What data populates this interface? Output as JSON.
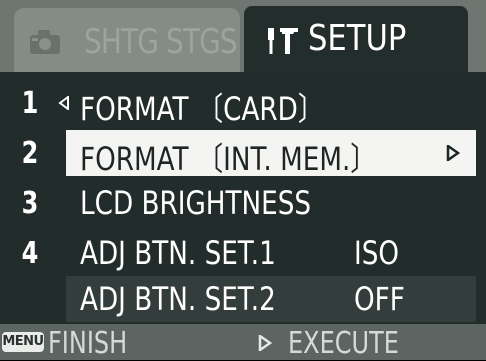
{
  "tabs": [
    {
      "label": "SHTG STGS",
      "icon": "camera-icon",
      "active": false
    },
    {
      "label": "SETUP",
      "icon": "wrench-icon",
      "active": true
    }
  ],
  "menu": {
    "items": [
      {
        "number": "1",
        "label": "FORMAT 〔CARD〕",
        "value": ""
      },
      {
        "number": "2",
        "label": "FORMAT 〔INT. MEM.〕",
        "value": "",
        "selected": true
      },
      {
        "number": "3",
        "label": "LCD BRIGHTNESS",
        "value": ""
      },
      {
        "number": "4",
        "label": "ADJ BTN. SET.1",
        "value": "ISO"
      },
      {
        "number": "",
        "label": "ADJ BTN. SET.2",
        "value": "OFF"
      }
    ]
  },
  "footer": {
    "menu_key": "MENU",
    "finish_label": "FINISH",
    "execute_label": "EXECUTE"
  },
  "colors": {
    "selected_bg": "#f4f4f2",
    "menu_bg": "#222c2a",
    "tabbar_bg": "#6f7672"
  }
}
